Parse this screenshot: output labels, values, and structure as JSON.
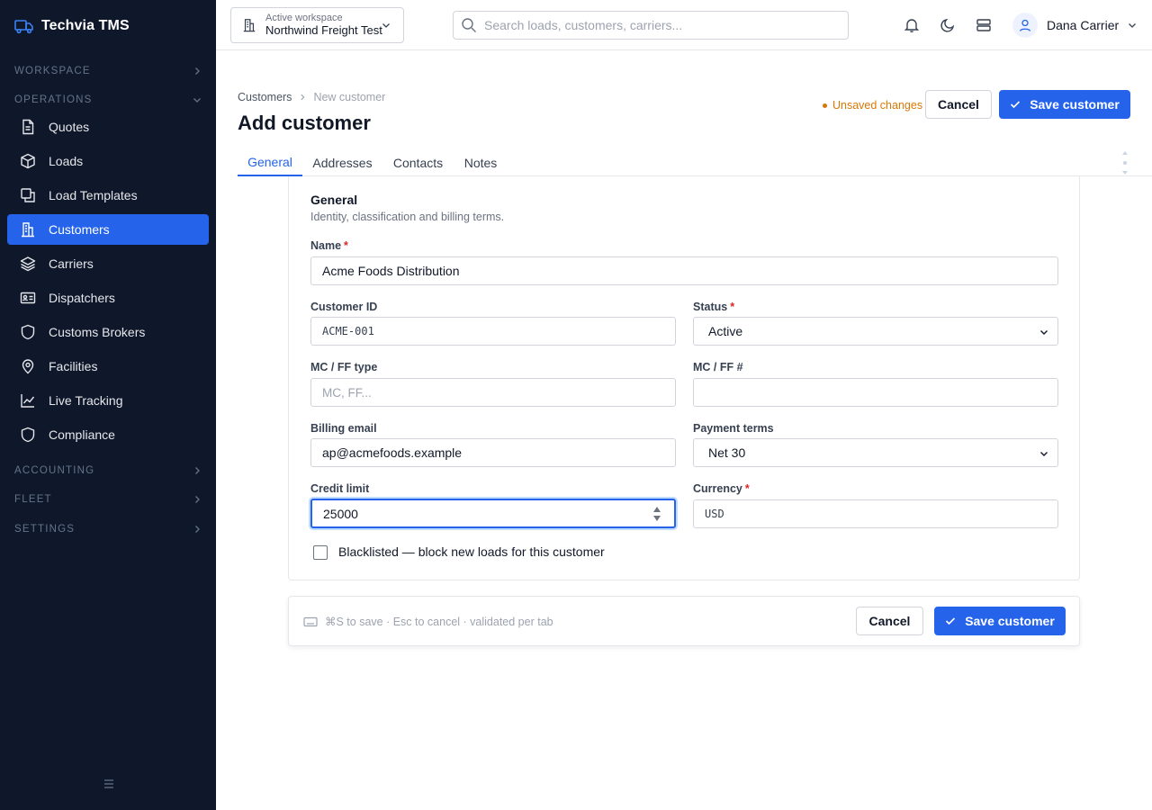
{
  "brand": {
    "name": "Techvia TMS"
  },
  "sidebar": {
    "sections": {
      "workspace": "WORKSPACE",
      "operations": "OPERATIONS",
      "accounting": "ACCOUNTING",
      "fleet": "FLEET",
      "settings": "SETTINGS"
    },
    "items": [
      {
        "label": "Quotes",
        "icon": "document-icon"
      },
      {
        "label": "Loads",
        "icon": "box-icon"
      },
      {
        "label": "Load Templates",
        "icon": "copy-icon"
      },
      {
        "label": "Customers",
        "icon": "building-icon",
        "active": true
      },
      {
        "label": "Carriers",
        "icon": "layers-icon"
      },
      {
        "label": "Dispatchers",
        "icon": "id-card-icon"
      },
      {
        "label": "Customs Brokers",
        "icon": "shield-icon"
      },
      {
        "label": "Facilities",
        "icon": "map-pin-icon"
      },
      {
        "label": "Live Tracking",
        "icon": "line-chart-icon"
      },
      {
        "label": "Compliance",
        "icon": "shield-icon"
      }
    ]
  },
  "topbar": {
    "workspace_caption": "Active workspace",
    "workspace_name": "Northwind Freight Test",
    "search_placeholder": "Search loads, customers, carriers...",
    "user_name": "Dana Carrier"
  },
  "breadcrumb": {
    "parent": "Customers",
    "current": "New customer"
  },
  "page_title": "Add customer",
  "header_actions": {
    "unsaved": "Unsaved changes",
    "cancel": "Cancel",
    "save": "Save customer"
  },
  "tabs": [
    "General",
    "Addresses",
    "Contacts",
    "Notes"
  ],
  "form": {
    "section_title": "General",
    "section_subtitle": "Identity, classification and billing terms.",
    "name": {
      "label": "Name",
      "value": "Acme Foods Distribution"
    },
    "customer_id": {
      "label": "Customer ID",
      "value": "ACME-001"
    },
    "status": {
      "label": "Status",
      "value": "Active"
    },
    "mc_type": {
      "label": "MC / FF type",
      "placeholder": "MC, FF..."
    },
    "mc_number": {
      "label": "MC / FF #",
      "value": ""
    },
    "billing_email": {
      "label": "Billing email",
      "value": "ap@acmefoods.example"
    },
    "payment_terms": {
      "label": "Payment terms",
      "value": "Net 30"
    },
    "credit_limit": {
      "label": "Credit limit",
      "value": "25000"
    },
    "currency": {
      "label": "Currency",
      "value": "USD"
    },
    "blacklisted": {
      "label": "Blacklisted — block new loads for this customer",
      "checked": false
    }
  },
  "footer": {
    "hint": "⌘S to save · Esc to cancel · validated per tab",
    "cancel": "Cancel",
    "save": "Save customer"
  },
  "colors": {
    "accent": "#2563eb",
    "sidebar": "#0f172a",
    "warning": "#d97706",
    "required": "#dc2626"
  }
}
